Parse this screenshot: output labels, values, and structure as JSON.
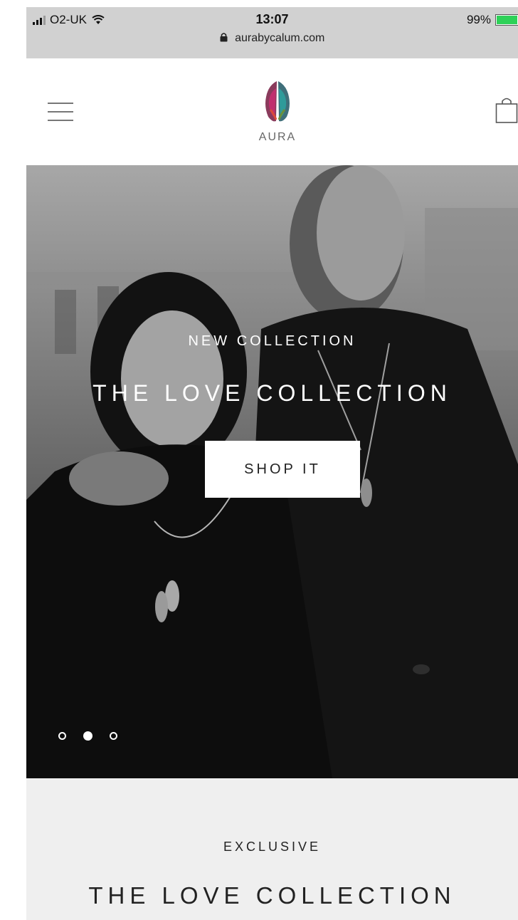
{
  "status_bar": {
    "carrier": "O2-UK",
    "time": "13:07",
    "url": "aurabycalum.com",
    "battery": "99%",
    "battery_level": 0.99
  },
  "header": {
    "logo_text": "AURA",
    "icons": [
      "hamburger-menu-icon",
      "shopping-bag-icon"
    ]
  },
  "hero": {
    "eyebrow": "NEW COLLECTION",
    "title": "THE LOVE COLLECTION",
    "cta_label": "SHOP IT",
    "slide_count": 3,
    "active_slide": 2
  },
  "section": {
    "eyebrow": "EXCLUSIVE",
    "title": "THE LOVE COLLECTION"
  },
  "colors": {
    "battery_green": "#2ed158",
    "section_bg": "#efefef",
    "statusbar_bg": "#d1d1d1"
  }
}
